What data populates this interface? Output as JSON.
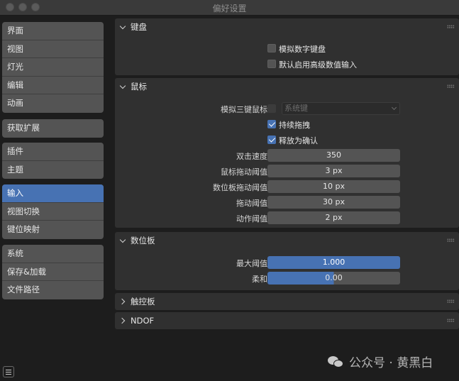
{
  "window": {
    "title": "偏好设置"
  },
  "sidebar": {
    "groups": [
      {
        "items": [
          "界面",
          "视图",
          "灯光",
          "编辑",
          "动画"
        ]
      },
      {
        "items": [
          "获取扩展"
        ]
      },
      {
        "items": [
          "插件",
          "主题"
        ]
      },
      {
        "items": [
          "输入",
          "视图切换",
          "键位映射"
        ]
      },
      {
        "items": [
          "系统",
          "保存&加载",
          "文件路径"
        ]
      }
    ],
    "active_item": "输入"
  },
  "panels": {
    "keyboard": {
      "title": "键盘",
      "options": [
        {
          "label": "模拟数字键盘",
          "checked": false
        },
        {
          "label": "默认启用高级数值输入",
          "checked": false
        }
      ]
    },
    "mouse": {
      "title": "鼠标",
      "emulate_3button": {
        "label": "模拟三键鼠标",
        "checked": false,
        "dropdown_value": "系统键"
      },
      "continuous_drag": {
        "label": "持续拖拽",
        "checked": true
      },
      "release_confirm": {
        "label": "释放为确认",
        "checked": true
      },
      "fields": [
        {
          "label": "双击速度",
          "value": "350"
        },
        {
          "label": "鼠标拖动阈值",
          "value": "3 px"
        },
        {
          "label": "数位板拖动阈值",
          "value": "10 px"
        },
        {
          "label": "拖动阈值",
          "value": "30 px"
        },
        {
          "label": "动作阈值",
          "value": "2 px"
        }
      ]
    },
    "tablet": {
      "title": "数位板",
      "fields": [
        {
          "label": "最大阈值",
          "value": "1.000",
          "fill": 1.0
        },
        {
          "label": "柔和",
          "value": "0.00",
          "fill": 0.5
        }
      ]
    },
    "touchpad": {
      "title": "触控板"
    },
    "ndof": {
      "title": "NDOF"
    }
  },
  "watermark": {
    "text": "公众号 · 黄黑白"
  },
  "colors": {
    "accent": "#4772b3",
    "panel": "#303030",
    "field": "#545454",
    "background": "#1d1d1d"
  }
}
